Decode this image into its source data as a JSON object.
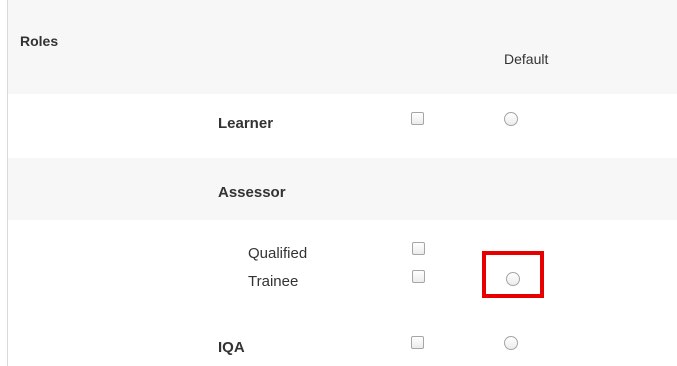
{
  "roles_section": {
    "title": "Roles",
    "default_header": "Default",
    "learner": {
      "label": "Learner",
      "checked": false,
      "default_selected": false
    },
    "assessor": {
      "label": "Assessor",
      "qualified": {
        "label": "Qualified",
        "checked": false
      },
      "trainee": {
        "label": "Trainee",
        "checked": false,
        "default_selected": false
      }
    },
    "iqa": {
      "label": "IQA",
      "checked": false,
      "default_selected": false
    }
  },
  "highlight": {
    "color": "#e60000",
    "target": "trainee-default-radio"
  }
}
